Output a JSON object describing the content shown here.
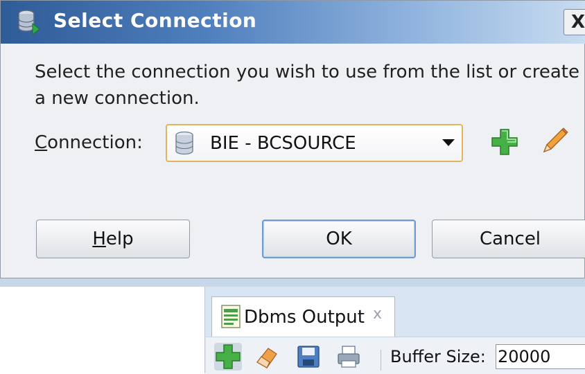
{
  "dialog": {
    "title": "Select Connection",
    "close_label": "X",
    "instructions": "Select the connection you wish to use from the list or create a new connection.",
    "connection_label_accel": "C",
    "connection_label_rest": "onnection:",
    "connection_value": "BIE - BCSOURCE",
    "buttons": {
      "help_accel": "H",
      "help_rest": "elp",
      "ok": "OK",
      "cancel": "Cancel"
    }
  },
  "output_panel": {
    "tab_label": "Dbms Output",
    "tab_close": "x",
    "buffer_label": "Buffer Size:",
    "buffer_value": "20000"
  },
  "icons": {
    "title": "database-connect-icon",
    "connection": "database-icon",
    "add": "plus-icon",
    "edit": "pencil-icon",
    "tab": "output-doc-icon",
    "toolbar": [
      "plus-icon",
      "eraser-icon",
      "save-icon",
      "print-icon"
    ]
  },
  "colors": {
    "title_bar_start": "#2f5b97",
    "title_bar_end": "#c9dcf0",
    "select_border": "#e1b35c",
    "ok_border": "#6f9bd0",
    "plus_green": "#3aa33a"
  }
}
